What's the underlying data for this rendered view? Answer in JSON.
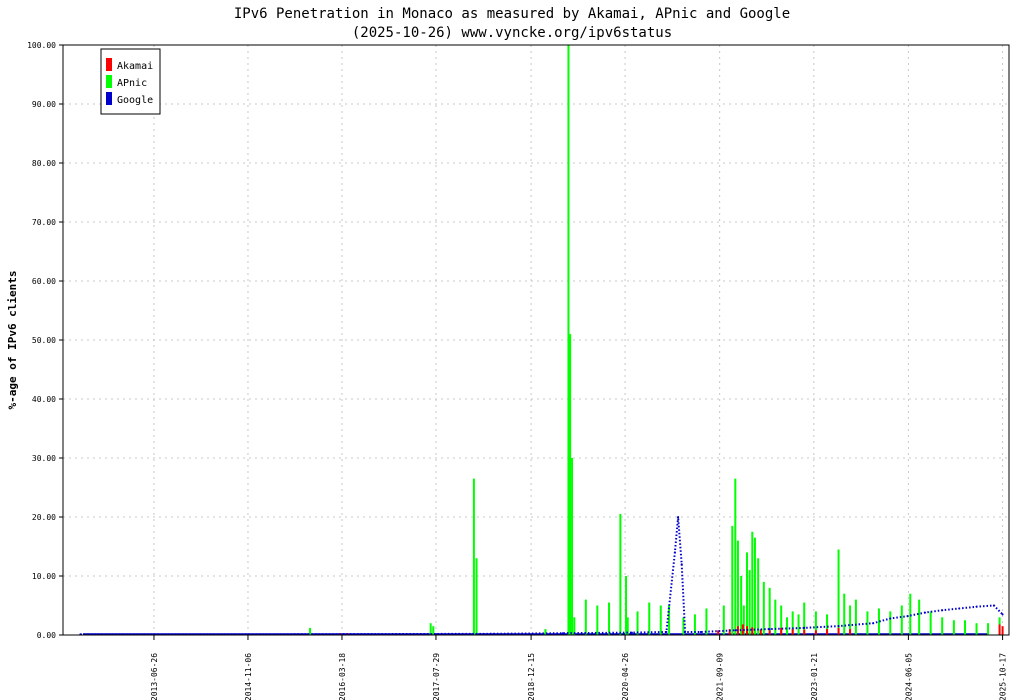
{
  "chart_data": {
    "type": "line",
    "title": "IPv6 Penetration in Monaco as measured by Akamai, APnic and Google",
    "subtitle": "(2025-10-26) www.vyncke.org/ipv6status",
    "ylabel": "%-age of IPv6 clients",
    "xlabel": "",
    "ylim": [
      0,
      100
    ],
    "xlim": [
      "2012-03-01",
      "2025-11-20"
    ],
    "grid": true,
    "legend_position": "top-left",
    "yticks": [
      "0.00",
      "10.00",
      "20.00",
      "30.00",
      "40.00",
      "50.00",
      "60.00",
      "70.00",
      "80.00",
      "90.00",
      "100.00"
    ],
    "xticks": [
      "2013-06-26",
      "2014-11-06",
      "2016-03-18",
      "2017-07-29",
      "2018-12-15",
      "2020-04-26",
      "2021-09-09",
      "2023-01-21",
      "2024-06-05",
      "2025-10-17"
    ],
    "series": [
      {
        "name": "Akamai",
        "color": "#ff0000",
        "style": "bar",
        "x": [
          "2016-03-10",
          "2016-04-15",
          "2021-09-01",
          "2021-11-01",
          "2021-12-15",
          "2022-01-10",
          "2022-02-01",
          "2022-03-01",
          "2022-04-15",
          "2022-06-01",
          "2022-08-01",
          "2022-10-01",
          "2022-12-01",
          "2023-02-01",
          "2023-04-01",
          "2023-06-01",
          "2023-08-01",
          "2025-10-01",
          "2025-10-17"
        ],
        "values": [
          0.3,
          0.3,
          0.8,
          1.0,
          1.5,
          1.8,
          1.5,
          1.3,
          1.0,
          0.8,
          1.2,
          1.0,
          0.9,
          0.8,
          1.0,
          1.2,
          1.0,
          1.8,
          1.5
        ]
      },
      {
        "name": "APnic",
        "color": "#00ff00",
        "style": "bar",
        "x": [
          "2015-10-01",
          "2017-07-01",
          "2017-07-15",
          "2018-02-15",
          "2018-03-01",
          "2019-03-01",
          "2019-07-01",
          "2019-07-10",
          "2019-07-20",
          "2019-08-01",
          "2019-10-01",
          "2019-12-01",
          "2020-02-01",
          "2020-04-01",
          "2020-05-01",
          "2020-05-10",
          "2020-07-01",
          "2020-09-01",
          "2020-11-01",
          "2020-12-15",
          "2021-03-01",
          "2021-05-01",
          "2021-07-01",
          "2021-10-01",
          "2021-11-15",
          "2021-12-01",
          "2021-12-15",
          "2022-01-01",
          "2022-01-15",
          "2022-02-01",
          "2022-02-15",
          "2022-03-01",
          "2022-03-15",
          "2022-04-01",
          "2022-05-01",
          "2022-06-01",
          "2022-07-01",
          "2022-08-01",
          "2022-09-01",
          "2022-10-01",
          "2022-11-01",
          "2022-12-01",
          "2023-02-01",
          "2023-04-01",
          "2023-06-01",
          "2023-07-01",
          "2023-08-01",
          "2023-09-01",
          "2023-11-01",
          "2024-01-01",
          "2024-03-01",
          "2024-05-01",
          "2024-06-15",
          "2024-08-01",
          "2024-10-01",
          "2024-12-01",
          "2025-02-01",
          "2025-04-01",
          "2025-06-01",
          "2025-08-01",
          "2025-10-01"
        ],
        "values": [
          1.2,
          2.0,
          1.5,
          26.5,
          13.0,
          1.0,
          100.0,
          51.0,
          30.0,
          3.0,
          6.0,
          5.0,
          5.5,
          20.5,
          10.0,
          3.0,
          4.0,
          5.5,
          5.0,
          5.0,
          3.0,
          3.5,
          4.5,
          5.0,
          18.5,
          26.5,
          16.0,
          10.0,
          5.0,
          14.0,
          11.0,
          17.5,
          16.5,
          13.0,
          9.0,
          8.0,
          6.0,
          5.0,
          3.0,
          4.0,
          3.5,
          5.5,
          4.0,
          3.5,
          14.5,
          7.0,
          5.0,
          6.0,
          4.0,
          4.5,
          4.0,
          5.0,
          7.0,
          6.0,
          4.0,
          3.0,
          2.5,
          2.5,
          2.0,
          2.0,
          3.0
        ]
      },
      {
        "name": "Google",
        "color": "#0000cc",
        "style": "dotted",
        "x": [
          "2012-06-01",
          "2015-01-01",
          "2018-06-01",
          "2019-06-01",
          "2020-06-01",
          "2020-12-01",
          "2021-01-15",
          "2021-02-01",
          "2021-02-20",
          "2021-03-10",
          "2021-06-01",
          "2021-12-01",
          "2022-06-01",
          "2022-12-01",
          "2023-06-01",
          "2023-12-01",
          "2024-03-01",
          "2024-06-01",
          "2024-09-01",
          "2024-12-01",
          "2025-03-01",
          "2025-06-01",
          "2025-09-01",
          "2025-10-17"
        ],
        "values": [
          0.1,
          0.1,
          0.2,
          0.3,
          0.4,
          0.5,
          14.0,
          20.0,
          12.0,
          0.5,
          0.5,
          0.8,
          1.0,
          1.2,
          1.5,
          2.0,
          2.8,
          3.2,
          3.8,
          4.2,
          4.5,
          4.8,
          5.0,
          3.5
        ]
      }
    ]
  }
}
